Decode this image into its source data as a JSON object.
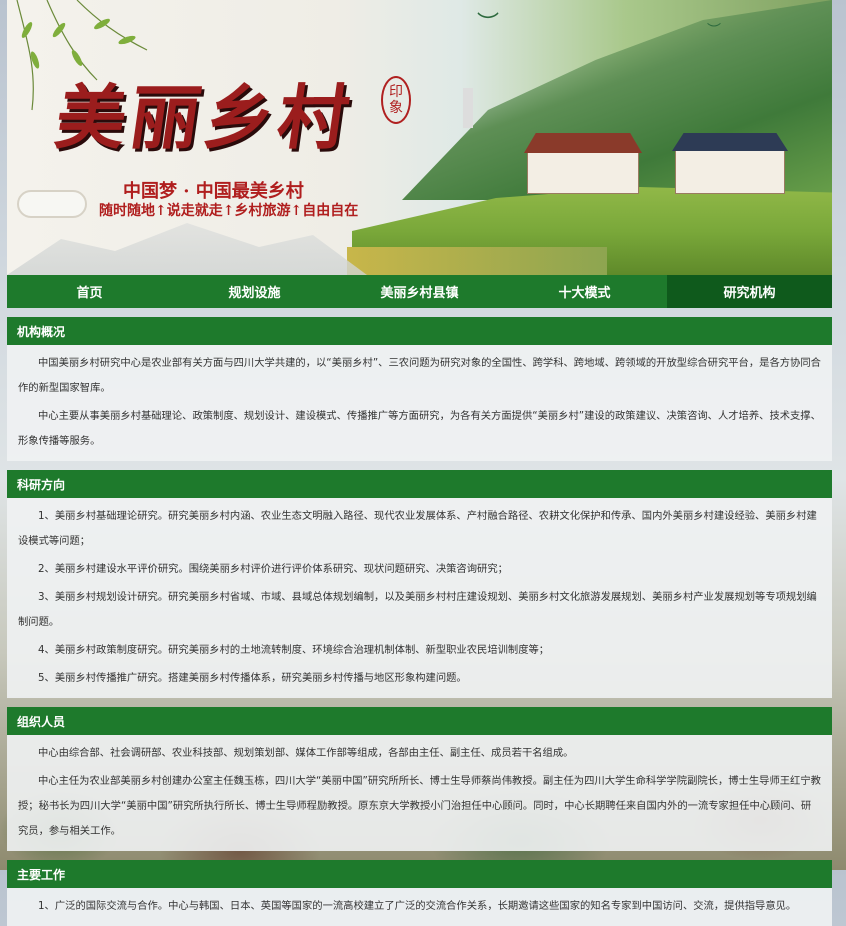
{
  "banner": {
    "title": "美丽乡村",
    "seal": [
      "印",
      "象"
    ],
    "slogan_main": "中国梦 · 中国最美乡村",
    "slogan_sub": "随时随地↑说走就走↑乡村旅游↑自由自在"
  },
  "nav": {
    "items": [
      {
        "label": "首页",
        "active": false
      },
      {
        "label": "规划设施",
        "active": false
      },
      {
        "label": "美丽乡村县镇",
        "active": false
      },
      {
        "label": "十大模式",
        "active": false
      },
      {
        "label": "研究机构",
        "active": true
      }
    ]
  },
  "sections": [
    {
      "title": "机构概况",
      "paragraphs": [
        "中国美丽乡村研究中心是农业部有关方面与四川大学共建的，以“美丽乡村”、三农问题为研究对象的全国性、跨学科、跨地域、跨领域的开放型综合研究平台，是各方协同合作的新型国家智库。",
        "中心主要从事美丽乡村基础理论、政策制度、规划设计、建设模式、传播推广等方面研究，为各有关方面提供“美丽乡村”建设的政策建议、决策咨询、人才培养、技术支撑、形象传播等服务。"
      ]
    },
    {
      "title": "科研方向",
      "paragraphs": [
        "1、美丽乡村基础理论研究。研究美丽乡村内涵、农业生态文明融入路径、现代农业发展体系、产村融合路径、农耕文化保护和传承、国内外美丽乡村建设经验、美丽乡村建设模式等问题；",
        "2、美丽乡村建设水平评价研究。围绕美丽乡村评价进行评价体系研究、现状问题研究、决策咨询研究；",
        "3、美丽乡村规划设计研究。研究美丽乡村省域、市域、县域总体规划编制，以及美丽乡村村庄建设规划、美丽乡村文化旅游发展规划、美丽乡村产业发展规划等专项规划编制问题。",
        "4、美丽乡村政策制度研究。研究美丽乡村的土地流转制度、环境综合治理机制体制、新型职业农民培训制度等；",
        "5、美丽乡村传播推广研究。搭建美丽乡村传播体系，研究美丽乡村传播与地区形象构建问题。"
      ]
    },
    {
      "title": "组织人员",
      "paragraphs": [
        "中心由综合部、社会调研部、农业科技部、规划策划部、媒体工作部等组成，各部由主任、副主任、成员若干名组成。",
        "中心主任为农业部美丽乡村创建办公室主任魏玉栋，四川大学“美丽中国”研究所所长、博士生导师蔡尚伟教授。副主任为四川大学生命科学学院副院长，博士生导师王红宁教授；秘书长为四川大学“美丽中国”研究所执行所长、博士生导师程励教授。原东京大学教授小门治担任中心顾问。同时，中心长期聘任来自国内外的一流专家担任中心顾问、研究员，参与相关工作。"
      ]
    },
    {
      "title": "主要工作",
      "paragraphs": [
        "1、广泛的国际交流与合作。中心与韩国、日本、英国等国家的一流高校建立了广泛的交流合作关系，长期邀请这些国家的知名专家到中国访问、交流，提供指导意见。"
      ]
    }
  ]
}
